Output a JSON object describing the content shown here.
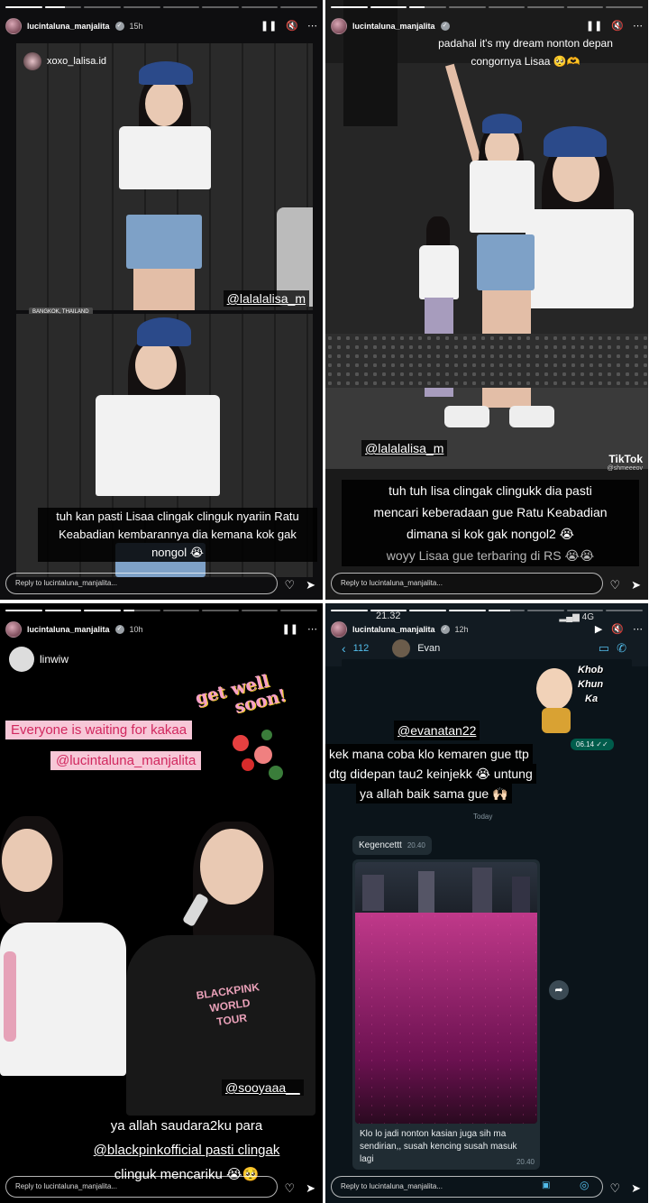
{
  "panels": [
    {
      "username": "lucintaluna_manjalita",
      "time": "15h",
      "progress": [
        1,
        0.55,
        0,
        0,
        0,
        0,
        0,
        0
      ],
      "repost_user": "xoxo_lalisa.id",
      "location": "BANGKOK, THAILAND",
      "tag": "@lalalalisa_m",
      "caption_lines": [
        "tuh kan pasti Lisaa clingak clinguk nyariin Ratu",
        "Keabadian kembarannya dia kemana kok gak nongol 😭"
      ],
      "reply_placeholder": "Reply to lucintaluna_manjalita..."
    },
    {
      "username": "lucintaluna_manjalita",
      "progress": [
        1,
        1,
        0.4,
        0,
        0,
        0,
        0,
        0
      ],
      "top_caption_lines": [
        "padahal it's my dream nonton depan",
        "congornya Lisaa 🥺🫶"
      ],
      "tag": "@lalalalisa_m",
      "caption_lines": [
        "tuh tuh lisa clingak clingukk dia pasti",
        "mencari keberadaan gue Ratu Keabadian",
        "dimana si kok gak nongol2 😭",
        "woyy Lisaa gue terbaring di RS 😭😭"
      ],
      "tiktok": "TikTok",
      "tiktok_user": "@shmeeeov",
      "reply_placeholder": "Reply to lucintaluna_manjalita..."
    },
    {
      "username": "lucintaluna_manjalita",
      "time": "10h",
      "progress": [
        1,
        1,
        1,
        0.3,
        0,
        0,
        0,
        0
      ],
      "repost_user": "linwiw",
      "getwell": [
        "get well",
        "soon!"
      ],
      "pink_lines": [
        "Everyone is waiting for  kakaa",
        "@lucintaluna_manjalita"
      ],
      "shirt_text": [
        "BLACKPINK",
        "WORLD",
        "TOUR"
      ],
      "tag": "@sooyaaa__",
      "caption_lines": [
        "ya allah saudara2ku para",
        "@blackpinkofficial pasti clingak",
        "clinguk mencariku 😭🥺"
      ],
      "reply_placeholder": "Reply to lucintaluna_manjalita..."
    },
    {
      "username": "lucintaluna_manjalita",
      "time": "12h",
      "status_time": "21.32",
      "network": "4G",
      "chat": {
        "back_count": "112",
        "contact": "Evan",
        "sticker_text": [
          "Khob",
          "Khun",
          "Ka"
        ],
        "out_time": "06.14 ✓✓",
        "tag": "@evanatan22",
        "caption_lines": [
          "kek mana coba klo kemaren gue ttp",
          "dtg didepan tau2 keinjekk 😭 untung",
          "ya allah baik sama gue 🙌🏻"
        ],
        "day_label": "Today",
        "msg1": "Kegencettt",
        "msg1_time": "20.40",
        "msg2": "Klo lo jadi nonton kasian juga sih ma sendirian,, susah kencing susah masuk lagi",
        "msg2_time": "20.40"
      },
      "reply_placeholder": "Reply to lucintaluna_manjalita..."
    }
  ]
}
